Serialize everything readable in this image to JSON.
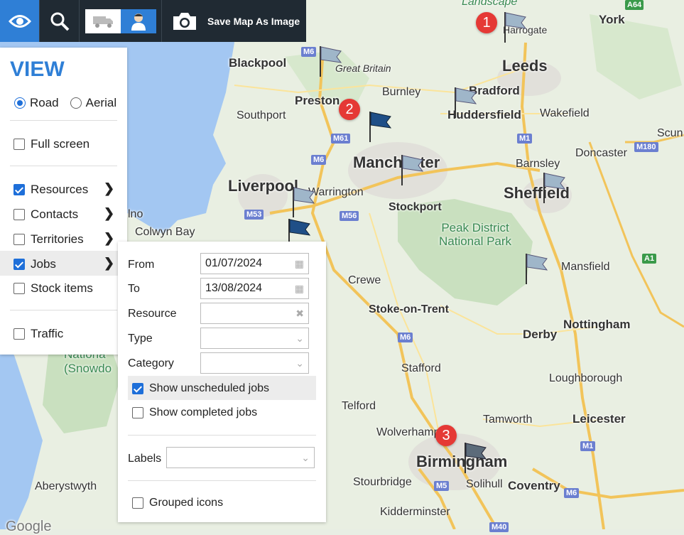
{
  "toolbar": {
    "save_label": "Save Map As Image",
    "icons": [
      "eye-icon",
      "search-icon",
      "truck-icon",
      "person-icon",
      "camera-icon"
    ]
  },
  "view_panel": {
    "title": "VIEW",
    "map_type": {
      "road": "Road",
      "aerial": "Aerial",
      "selected": "Road"
    },
    "full_screen": "Full screen",
    "layers": [
      {
        "label": "Resources",
        "checked": true
      },
      {
        "label": "Contacts",
        "checked": false
      },
      {
        "label": "Territories",
        "checked": false
      },
      {
        "label": "Jobs",
        "checked": true
      },
      {
        "label": "Stock items",
        "checked": false
      }
    ],
    "traffic": "Traffic"
  },
  "jobs_panel": {
    "from_label": "From",
    "from_value": "01/07/2024",
    "to_label": "To",
    "to_value": "13/08/2024",
    "resource_label": "Resource",
    "type_label": "Type",
    "category_label": "Category",
    "show_unscheduled": "Show unscheduled jobs",
    "show_completed": "Show completed jobs",
    "labels_label": "Labels",
    "grouped_icons": "Grouped icons"
  },
  "map": {
    "pins": [
      "1",
      "2",
      "3"
    ],
    "places": {
      "landscape": "Landscape",
      "york": "York",
      "harrogate": "Harrogate",
      "leeds": "Leeds",
      "blackpool": "Blackpool",
      "great_britain": "Great Britain",
      "burnley": "Burnley",
      "bradford": "Bradford",
      "preston": "Preston",
      "huddersfield": "Huddersfield",
      "wakefield": "Wakefield",
      "southport": "Southport",
      "scunthorpe": "Scun",
      "doncaster": "Doncaster",
      "manchester": "Manchester",
      "barnsley": "Barnsley",
      "liverpool": "Liverpool",
      "warrington": "Warrington",
      "sheffield": "Sheffield",
      "stockport": "Stockport",
      "llandudno": "lno",
      "colwyn_bay": "Colwyn Bay",
      "peak_district": "Peak District\nNational Park",
      "mansfield": "Mansfield",
      "crewe": "Crewe",
      "stoke": "Stoke-on-Trent",
      "nottingham": "Nottingham",
      "derby": "Derby",
      "snowdonia": "(Snowdo",
      "national": "Nationa",
      "stafford": "Stafford",
      "loughborough": "Loughborough",
      "telford": "Telford",
      "tamworth": "Tamworth",
      "leicester": "Leicester",
      "wolverhampton": "Wolverhampton",
      "birmingham": "Birmingham",
      "aberystwyth": "Aberystwyth",
      "stourbridge": "Stourbridge",
      "solihull": "Solihull",
      "coventry": "Coventry",
      "kidderminster": "Kidderminster",
      "google": "Google"
    },
    "roads": [
      "M6",
      "M61",
      "M6",
      "M53",
      "M56",
      "M1",
      "M180",
      "A1",
      "M6",
      "M5",
      "M1",
      "M6",
      "M40",
      "A64"
    ]
  }
}
